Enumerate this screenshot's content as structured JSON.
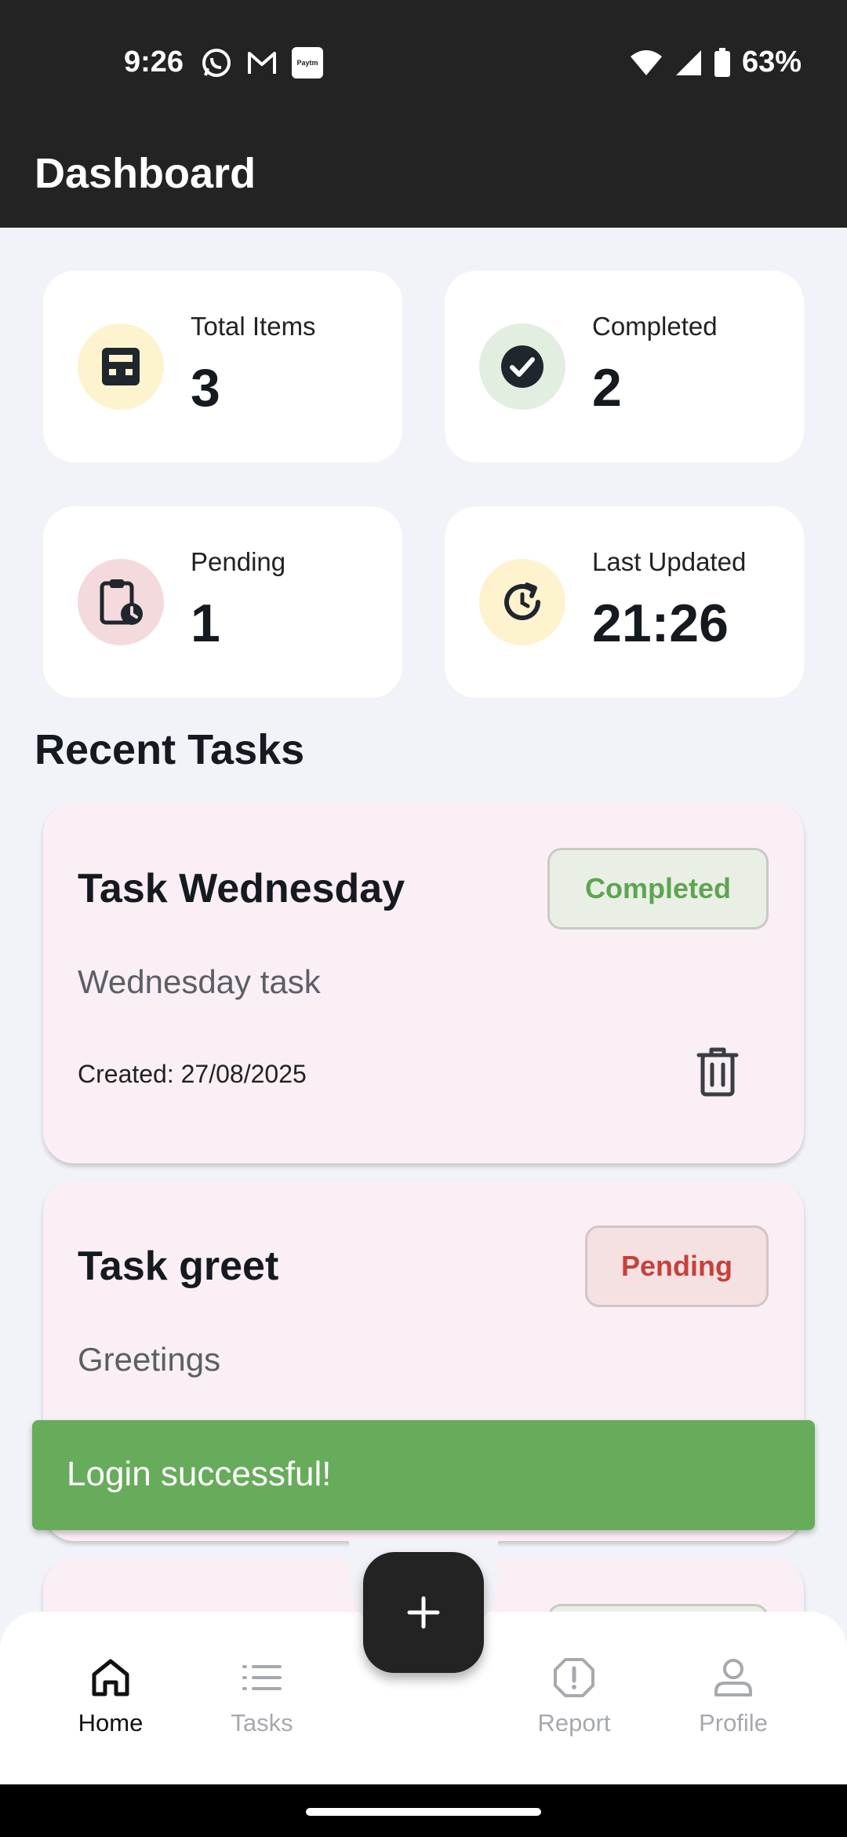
{
  "status_bar": {
    "time": "9:26",
    "left_icons": [
      "whatsapp-icon",
      "gmail-icon",
      "paytm-icon"
    ],
    "paytm_text": "Paytm",
    "battery": "63%",
    "right_icons": [
      "wifi-icon",
      "signal-icon",
      "battery-icon"
    ]
  },
  "app_bar": {
    "title": "Dashboard"
  },
  "stats": [
    {
      "label": "Total Items",
      "value": "3",
      "icon": "inbox-icon",
      "icon_bg": "#fdf3cf"
    },
    {
      "label": "Completed",
      "value": "2",
      "icon": "check-circle-icon",
      "icon_bg": "#e1eee0"
    },
    {
      "label": "Pending",
      "value": "1",
      "icon": "clipboard-clock-icon",
      "icon_bg": "#f4dadd"
    },
    {
      "label": "Last Updated",
      "value": "21:26",
      "icon": "refresh-clock-icon",
      "icon_bg": "#fdf3cf"
    }
  ],
  "section": {
    "title": "Recent Tasks"
  },
  "tasks": [
    {
      "title": "Task Wednesday",
      "description": "Wednesday task",
      "created": "Created: 27/08/2025",
      "status": "Completed",
      "delete_icon": "trash-icon"
    },
    {
      "title": "Task greet",
      "description": "Greetings",
      "status": "Pending"
    }
  ],
  "snackbar": {
    "message": "Login successful!",
    "color": "#67ac5b"
  },
  "fab": {
    "icon": "plus-icon"
  },
  "bottom_nav": {
    "items": [
      {
        "label": "Home",
        "icon": "home-icon",
        "active": true
      },
      {
        "label": "Tasks",
        "icon": "list-icon",
        "active": false
      },
      {
        "label": "Report",
        "icon": "alert-circle-icon",
        "active": false
      },
      {
        "label": "Profile",
        "icon": "person-icon",
        "active": false
      }
    ]
  },
  "colors": {
    "app_bar": "#232323",
    "background": "#f1f3f8",
    "task_card": "#faeff4",
    "completed": "#5ea552",
    "pending": "#c6403c"
  }
}
